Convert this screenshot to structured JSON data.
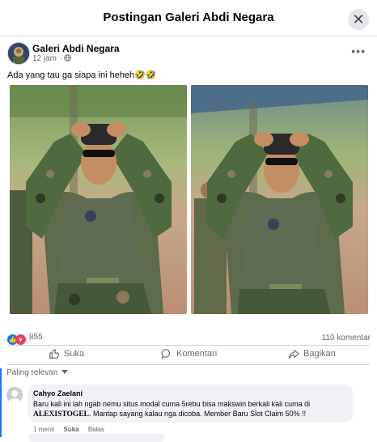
{
  "header": {
    "title": "Postingan Galeri Abdi Negara",
    "close": "✕"
  },
  "post": {
    "page_name": "Galeri Abdi Negara",
    "time": "12 jam",
    "privacy_icon": "globe-icon",
    "caption": "Ada yang tau ga siapa ini heheh🤣🤣",
    "more": "•••"
  },
  "stats": {
    "reactions": "855",
    "comments": "110 komentar"
  },
  "actions": {
    "like": "Suka",
    "comment": "Komentari",
    "share": "Bagikan"
  },
  "comments_section": {
    "sort_label": "Paling relevan",
    "items": [
      {
        "author": "Cahyo Zaelani",
        "text_before": "Baru kali ini lah ngab nemu situs modal cuma 5rebu bisa makswin berkali kali cuma di ",
        "brand": "ALEXISTOGEL",
        "text_after": ". Mantap sayang kalau nga dicoba. Member Baru Slot Claim 50% !!",
        "time": "1 menit",
        "like": "Suka",
        "reply": "Balas"
      }
    ]
  },
  "colors": {
    "accent": "#1877f2",
    "love": "#f33e58",
    "secondary_text": "#65676b"
  }
}
